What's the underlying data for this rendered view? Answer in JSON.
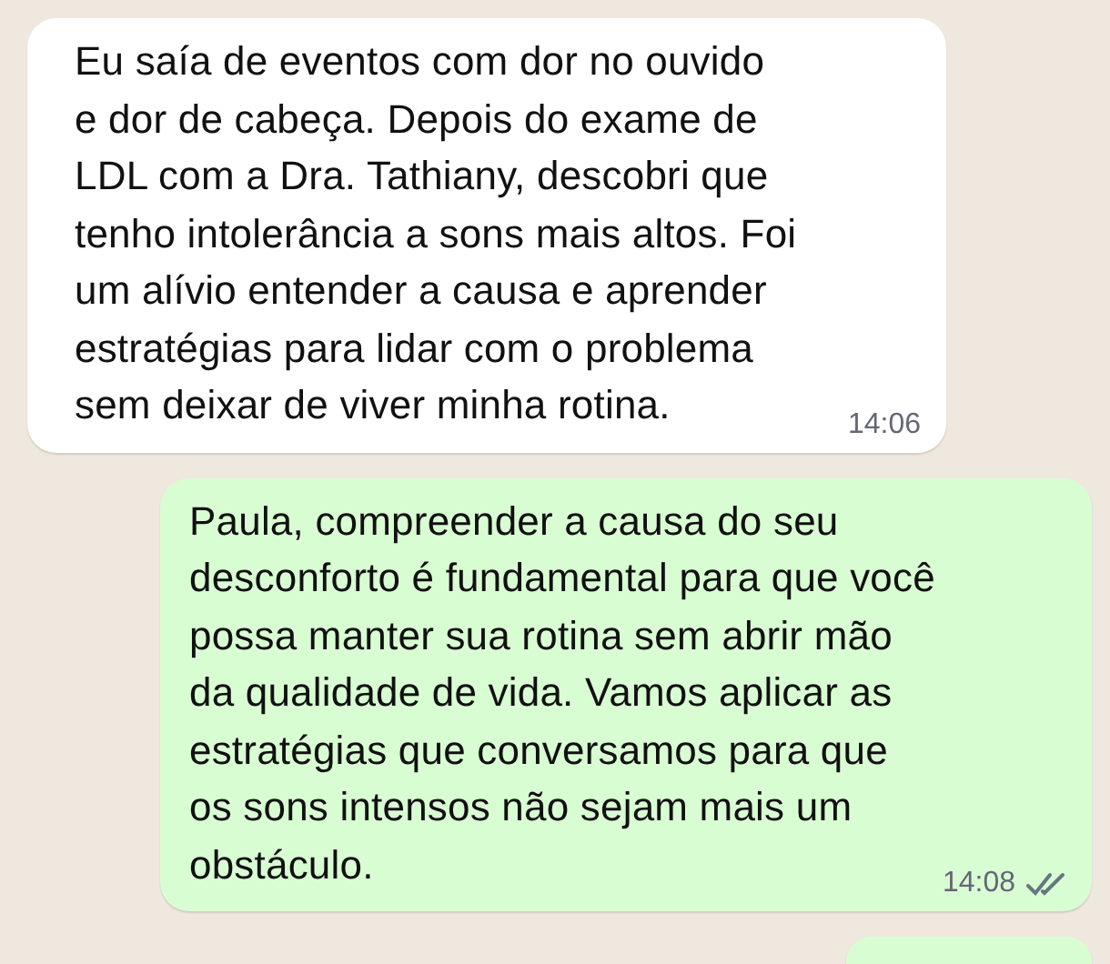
{
  "messages": [
    {
      "outgoing": false,
      "kind": "text",
      "text": "Eu saía de eventos com dor no ouvido\ne dor de cabeça. Depois do exame de\nLDL com a Dra. Tathiany, descobri que\ntenho intolerância a sons mais altos. Foi\num alívio entender a causa e aprender\nestratégias para lidar com o problema\nsem deixar de viver minha rotina.",
      "time": "14:06"
    },
    {
      "outgoing": true,
      "kind": "text",
      "text": "Paula, compreender a causa do seu\ndesconforto é fundamental para que você\npossa manter sua rotina sem abrir mão\nda qualidade de vida. Vamos aplicar as\nestratégias que conversamos para que\nos sons intensos não sejam mais um\nobstáculo.",
      "time": "14:08",
      "delivered": true
    },
    {
      "outgoing": true,
      "kind": "cut"
    }
  ]
}
